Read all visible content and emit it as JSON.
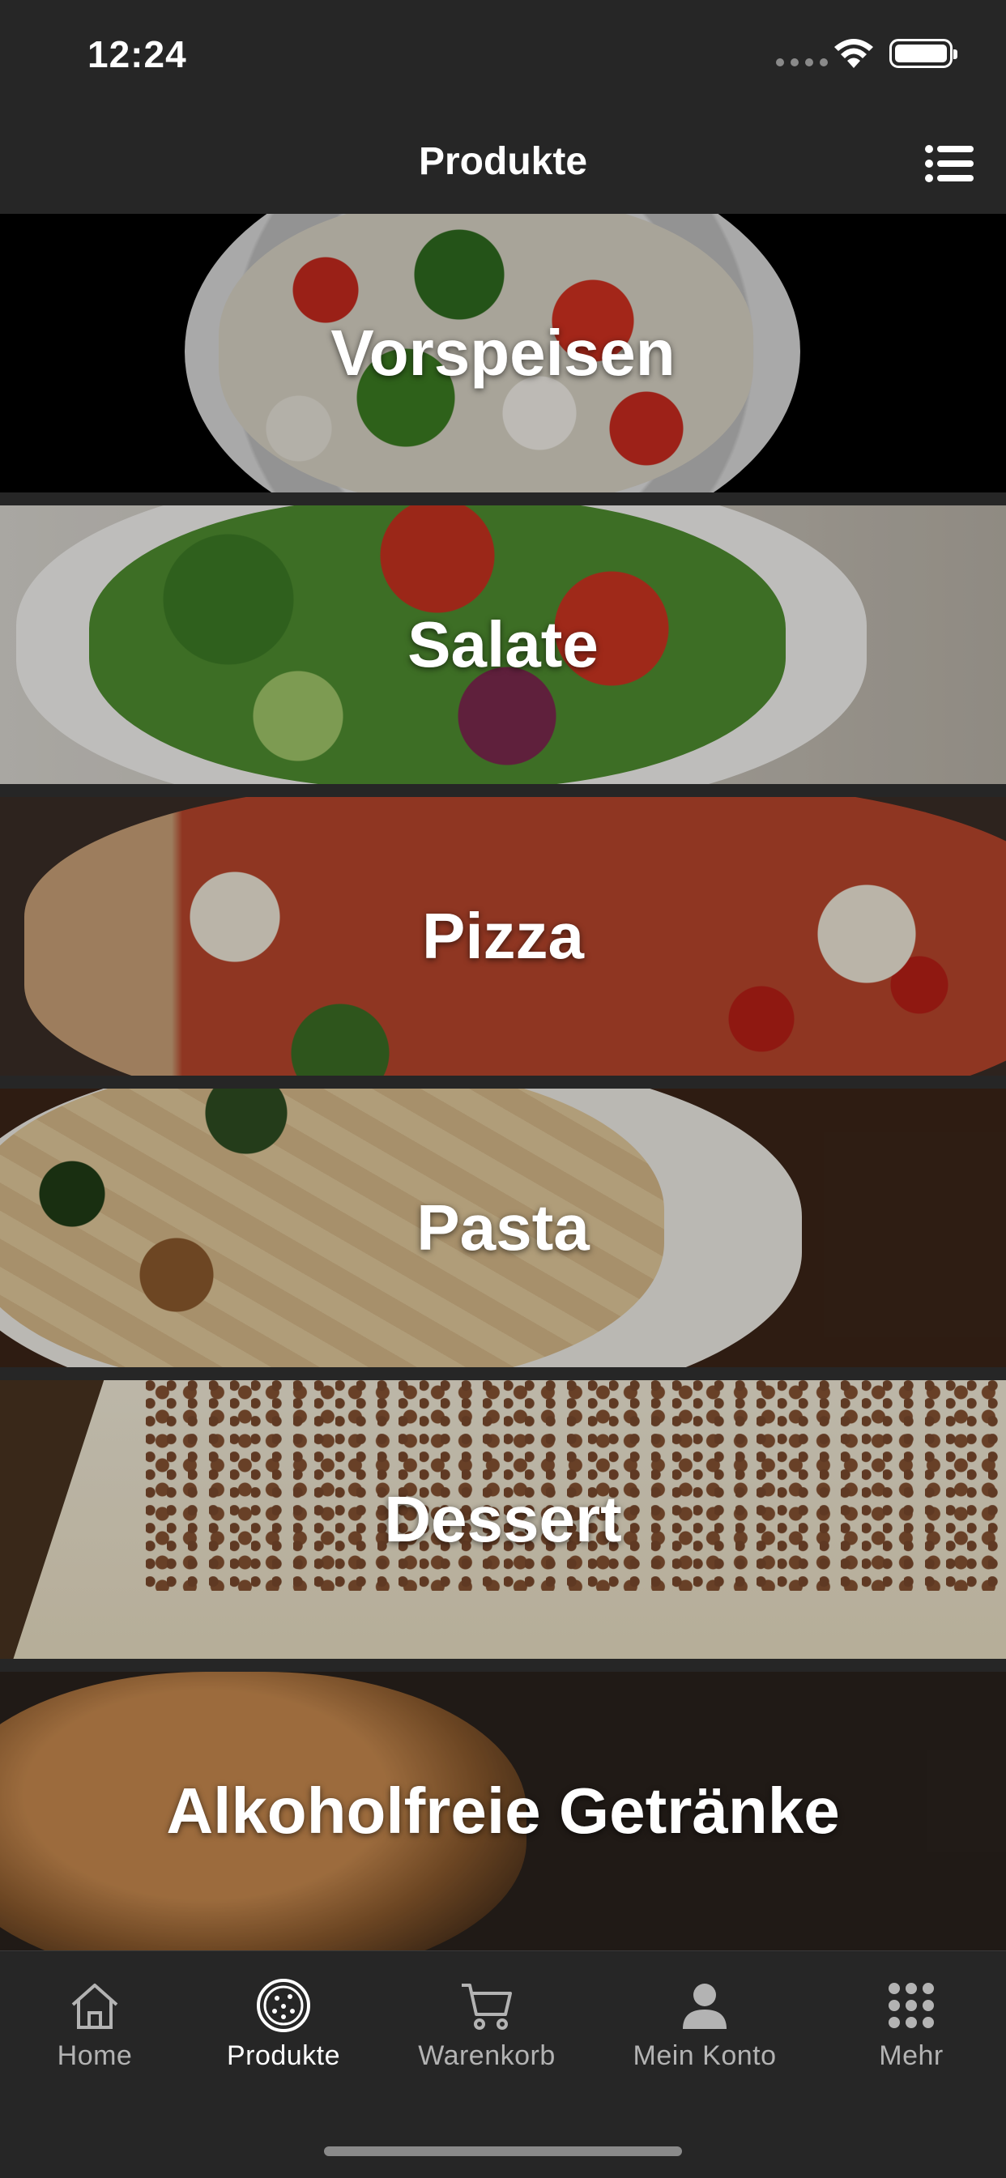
{
  "status_bar": {
    "time": "12:24"
  },
  "header": {
    "title": "Produkte",
    "menu_icon": "list-icon"
  },
  "categories": [
    {
      "label": "Vorspeisen"
    },
    {
      "label": "Salate"
    },
    {
      "label": "Pizza"
    },
    {
      "label": "Pasta"
    },
    {
      "label": "Dessert"
    },
    {
      "label": "Alkoholfreie Getränke"
    }
  ],
  "tabbar": {
    "active": "Produkte",
    "items": [
      {
        "label": "Home",
        "icon": "home-icon"
      },
      {
        "label": "Produkte",
        "icon": "pizza-icon"
      },
      {
        "label": "Warenkorb",
        "icon": "cart-icon"
      },
      {
        "label": "Mein Konto",
        "icon": "user-icon"
      },
      {
        "label": "Mehr",
        "icon": "grid-icon"
      }
    ]
  }
}
